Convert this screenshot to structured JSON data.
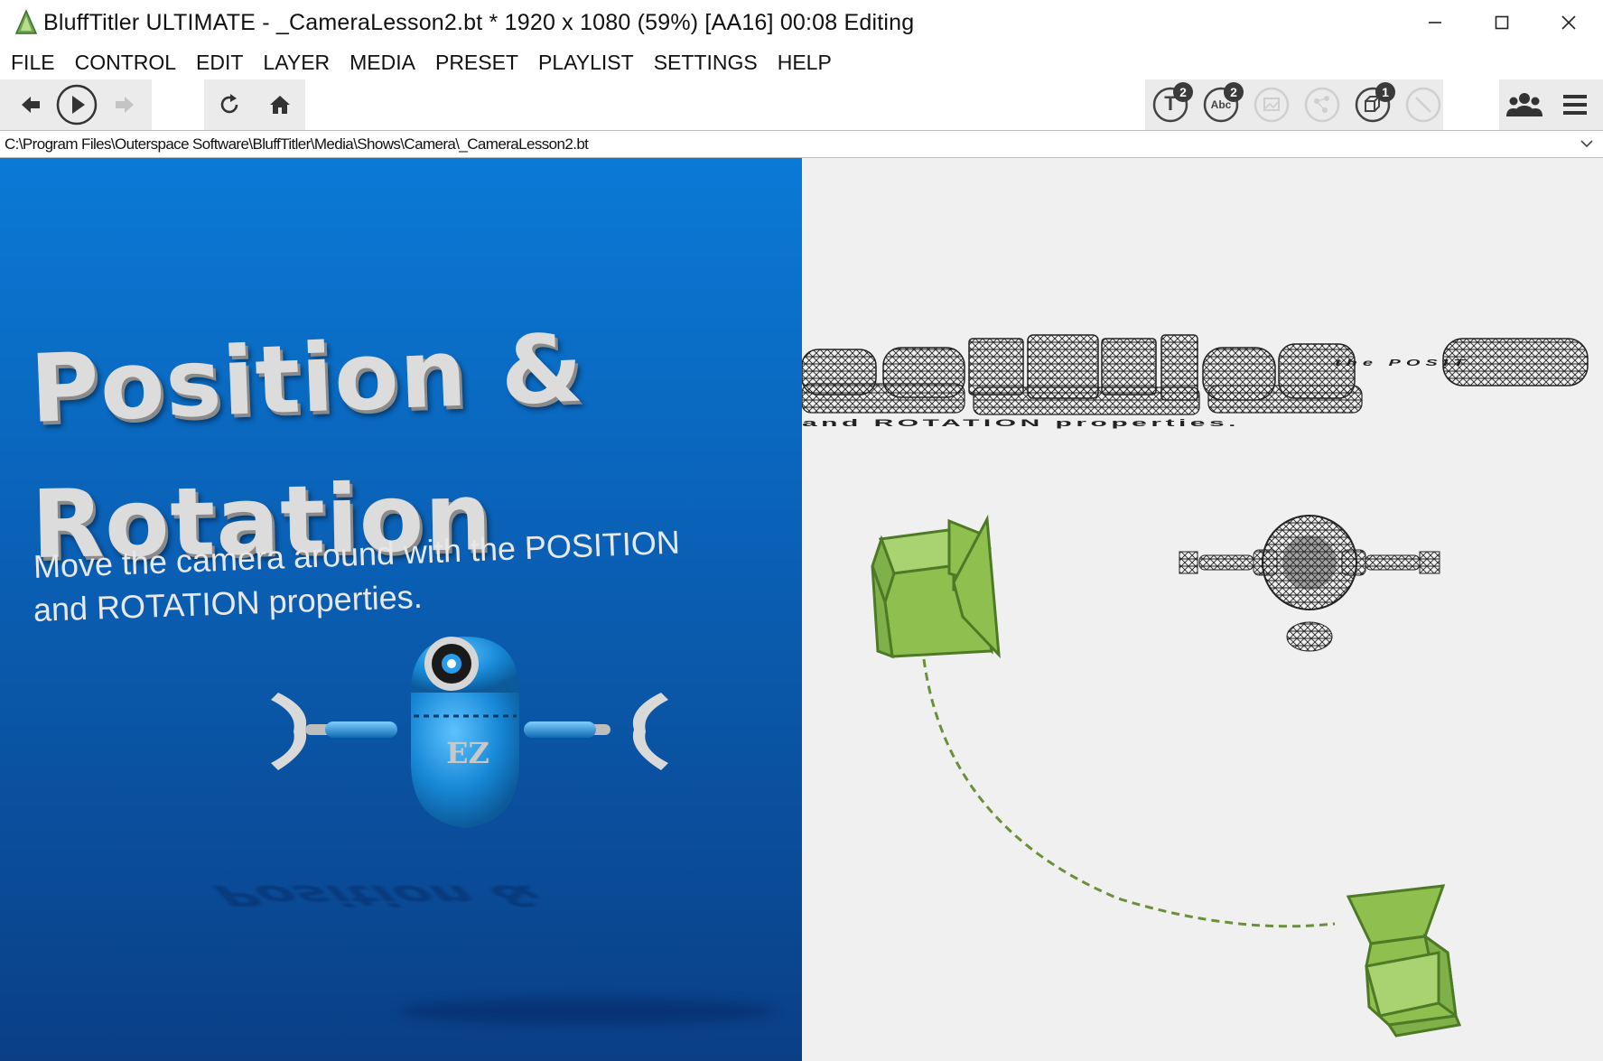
{
  "window": {
    "title": "BluffTitler ULTIMATE  - _CameraLesson2.bt * 1920 x 1080 (59%) [AA16] 00:08 Editing"
  },
  "menu": [
    "FILE",
    "CONTROL",
    "EDIT",
    "LAYER",
    "MEDIA",
    "PRESET",
    "PLAYLIST",
    "SETTINGS",
    "HELP"
  ],
  "toolbar": {
    "badges": {
      "text_layers": "2",
      "abc_layers": "2",
      "model_layers": "1"
    },
    "text_layer_glyph": "T",
    "abc_layer_glyph": "Abc"
  },
  "path": {
    "value": "C:\\Program Files\\Outerspace Software\\BluffTitler\\Media\\Shows\\Camera\\_CameraLesson2.bt"
  },
  "preview": {
    "title_line1": "Position &",
    "title_line2": "Rotation",
    "subtitle_line1": "Move the camera around with the POSITION",
    "subtitle_line2": "and ROTATION properties.",
    "robot_label": "EZ",
    "reflection": "Position &"
  },
  "editor": {
    "wire_text": "and ROTATION properties.",
    "wire_text_right": "the POSIT"
  },
  "colors": {
    "preview_top": "#0a7ad6",
    "preview_bottom": "#0a3f86",
    "camera_green": "#8fbf4f",
    "camera_outline": "#5c8a2a",
    "editor_bg": "#f0f0f0"
  }
}
